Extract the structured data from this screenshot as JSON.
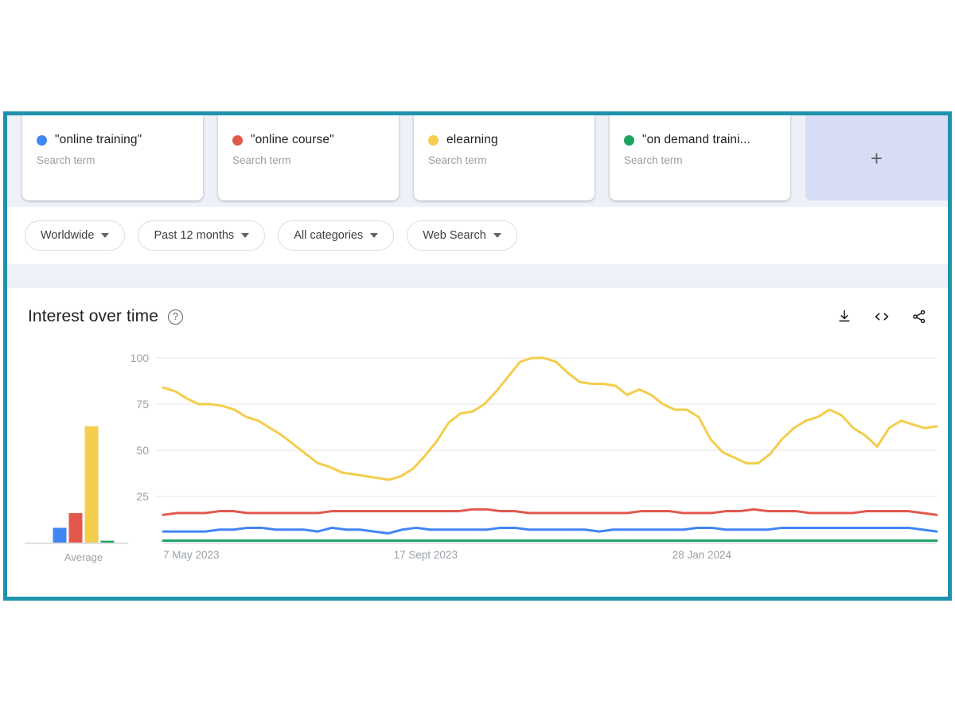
{
  "terms": [
    {
      "label": "\"online training\"",
      "sub": "Search term",
      "color": "#4285f4",
      "dot_name": "series-dot-blue"
    },
    {
      "label": "\"online course\"",
      "sub": "Search term",
      "color": "#e2584d",
      "dot_name": "series-dot-red"
    },
    {
      "label": "elearning",
      "sub": "Search term",
      "color": "#f4cd4c",
      "dot_name": "series-dot-yellow"
    },
    {
      "label": "\"on demand traini...",
      "sub": "Search term",
      "color": "#1aa260",
      "dot_name": "series-dot-green"
    }
  ],
  "add_card": {
    "icon": "plus-icon",
    "label": "+"
  },
  "filters": [
    {
      "label": "Worldwide"
    },
    {
      "label": "Past 12 months"
    },
    {
      "label": "All categories"
    },
    {
      "label": "Web Search"
    }
  ],
  "panel": {
    "title": "Interest over time",
    "help_glyph": "?",
    "actions": [
      {
        "name": "download-icon",
        "tooltip": "Download"
      },
      {
        "name": "embed-code-icon",
        "tooltip": "Embed"
      },
      {
        "name": "share-icon",
        "tooltip": "Share"
      }
    ]
  },
  "chart_data": {
    "type": "line",
    "title": "Interest over time",
    "xlabel": "",
    "ylabel": "",
    "ylim": [
      0,
      100
    ],
    "yticks": [
      25,
      50,
      75,
      100
    ],
    "grid": true,
    "legend_position": "top-cards",
    "xticks": [
      "7 May 2023",
      "17 Sept 2023",
      "28 Jan 2024"
    ],
    "xtick_positions": [
      0,
      0.3393,
      0.6964
    ],
    "x_count": 56,
    "series": [
      {
        "name": "\"online training\"",
        "color": "#4285f4",
        "average": 8,
        "values": [
          6,
          6,
          6,
          6,
          7,
          7,
          8,
          8,
          7,
          7,
          7,
          6,
          8,
          7,
          7,
          6,
          5,
          7,
          8,
          7,
          7,
          7,
          7,
          7,
          8,
          8,
          7,
          7,
          7,
          7,
          7,
          6,
          7,
          7,
          7,
          7,
          7,
          7,
          8,
          8,
          7,
          7,
          7,
          7,
          8,
          8,
          8,
          8,
          8,
          8,
          8,
          8,
          8,
          8,
          7,
          6
        ]
      },
      {
        "name": "\"online course\"",
        "color": "#e2584d",
        "average": 16,
        "values": [
          15,
          16,
          16,
          16,
          17,
          17,
          16,
          16,
          16,
          16,
          16,
          16,
          17,
          17,
          17,
          17,
          17,
          17,
          17,
          17,
          17,
          17,
          18,
          18,
          17,
          17,
          16,
          16,
          16,
          16,
          16,
          16,
          16,
          16,
          17,
          17,
          17,
          16,
          16,
          16,
          17,
          17,
          18,
          17,
          17,
          17,
          16,
          16,
          16,
          16,
          17,
          17,
          17,
          17,
          16,
          15
        ]
      },
      {
        "name": "elearning",
        "color": "#f4cd4c",
        "average": 63,
        "values": [
          84,
          82,
          78,
          75,
          75,
          74,
          72,
          68,
          66,
          62,
          58,
          53,
          48,
          43,
          41,
          38,
          37,
          36,
          35,
          34,
          36,
          40,
          47,
          55,
          65,
          70,
          71,
          75,
          82,
          90,
          98,
          100,
          100,
          98,
          92,
          87,
          86,
          86,
          85,
          80,
          83,
          80,
          75,
          72,
          72,
          68,
          56,
          49,
          46,
          43,
          43,
          48,
          56,
          62,
          66,
          68,
          72,
          69,
          62,
          58,
          52,
          62,
          66,
          64,
          62,
          63
        ]
      },
      {
        "name": "\"on demand traini...",
        "color": "#1aa260",
        "average": 1,
        "values": [
          1,
          1,
          1,
          1,
          1,
          1,
          1,
          1,
          1,
          1,
          1,
          1,
          1,
          1,
          1,
          1,
          1,
          1,
          1,
          1,
          1,
          1,
          1,
          1,
          1,
          1,
          1,
          1,
          1,
          1,
          1,
          1,
          1,
          1,
          1,
          1,
          1,
          1,
          1,
          1,
          1,
          1,
          1,
          1,
          1,
          1,
          1,
          1,
          1,
          1,
          1,
          1,
          1,
          1,
          1,
          1
        ]
      }
    ],
    "average_panel": {
      "label": "Average",
      "values": [
        8,
        16,
        63,
        1
      ]
    }
  }
}
